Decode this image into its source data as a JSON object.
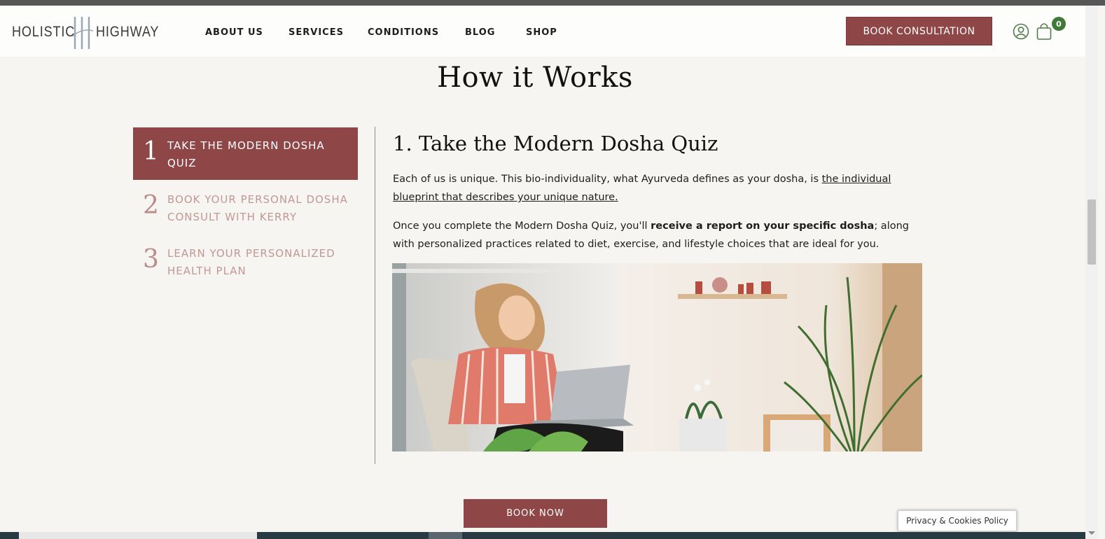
{
  "header": {
    "logo": {
      "left": "HOLISTIC",
      "right": "HIGHWAY"
    },
    "nav": [
      "ABOUT US",
      "SERVICES",
      "CONDITIONS",
      "BLOG",
      "SHOP"
    ],
    "cta_label": "BOOK CONSULTATION",
    "cart_count": "0",
    "icons": [
      "user-icon",
      "shopping-bag-icon"
    ]
  },
  "section": {
    "title": "How it Works"
  },
  "steps": [
    {
      "number": "1",
      "label": "TAKE THE MODERN DOSHA QUIZ",
      "active": true
    },
    {
      "number": "2",
      "label": "BOOK YOUR PERSONAL DOSHA CONSULT WITH KERRY",
      "active": false
    },
    {
      "number": "3",
      "label": "LEARN YOUR PERSONALIZED HEALTH PLAN",
      "active": false
    }
  ],
  "content": {
    "title": "1. Take the Modern Dosha Quiz",
    "p1_text": "Each of us is unique. This bio-individuality, what Ayurveda defines as your dosha, is ",
    "p1_link": "the individual blueprint that describes your unique nature.",
    "p2_pre": "Once you complete the Modern Dosha Quiz, you'll ",
    "p2_bold": "receive a report on your specific dosha",
    "p2_post": "; along with personalized practices related to diet, exercise, and lifestyle choices that are ideal for you."
  },
  "book_now_label": "BOOK NOW",
  "privacy_label": "Privacy & Cookies Policy",
  "colors": {
    "accent": "#8e4646",
    "background": "#f7f5f1",
    "badge": "#3f7a37"
  }
}
